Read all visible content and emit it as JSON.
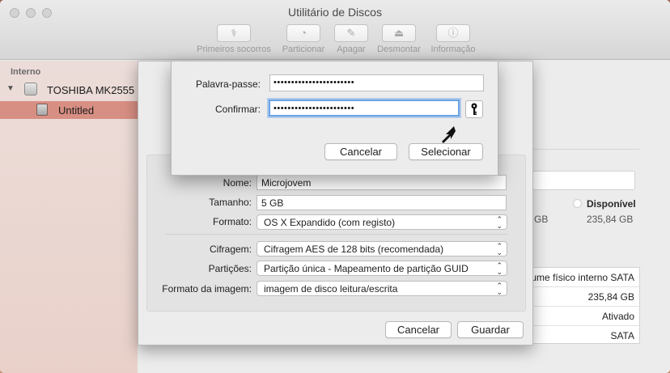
{
  "window": {
    "title": "Utilitário de Discos"
  },
  "toolbar": {
    "items": [
      {
        "label": "Primeiros socorros",
        "icon": "first-aid-icon"
      },
      {
        "label": "Particionar",
        "icon": "partition-icon"
      },
      {
        "label": "Apagar",
        "icon": "erase-icon"
      },
      {
        "label": "Desmontar",
        "icon": "unmount-icon"
      },
      {
        "label": "Informação",
        "icon": "info-icon"
      }
    ]
  },
  "sidebar": {
    "header": "Interno",
    "disk": "TOSHIBA MK2555",
    "volume": "Untitled"
  },
  "main": {
    "available_label": "Disponível",
    "available_value": "235,84 GB",
    "partial_gb": "GB",
    "info_rows": [
      "lume físico interno SATA",
      "235,84 GB",
      "Ativado",
      "SATA"
    ]
  },
  "image_sheet": {
    "name_label": "Nome:",
    "name_value": "Microjovem",
    "size_label": "Tamanho:",
    "size_value": "5 GB",
    "format_label": "Formato:",
    "format_value": "OS X Expandido (com registo)",
    "encryption_label": "Cifragem:",
    "encryption_value": "Cifragem AES de 128 bits (recomendada)",
    "partitions_label": "Partições:",
    "partitions_value": "Partição única - Mapeamento de partição GUID",
    "image_format_label": "Formato da imagem:",
    "image_format_value": "imagem de disco leitura/escrita",
    "cancel_label": "Cancelar",
    "save_label": "Guardar"
  },
  "password_sheet": {
    "password_label": "Palavra-passe:",
    "password_value": "•••••••••••••••••••••••",
    "confirm_label": "Confirmar:",
    "confirm_value": "•••••••••••••••••••••••",
    "cancel_label": "Cancelar",
    "select_label": "Selecionar"
  }
}
